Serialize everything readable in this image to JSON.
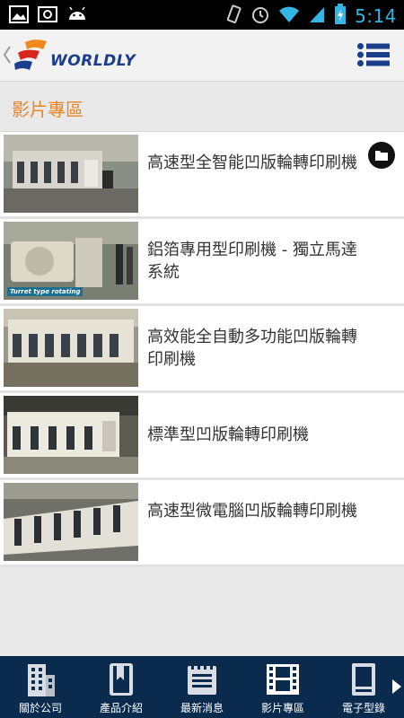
{
  "status_bar": {
    "time": "5:14"
  },
  "header": {
    "brand": "WORLDLY"
  },
  "section": {
    "title": "影片專區"
  },
  "videos": [
    {
      "title": "高速型全智能凹版輪轉印刷機"
    },
    {
      "title": "鋁箔專用型印刷機 - 獨立馬達系統",
      "thumb_caption": "Turret type rotating"
    },
    {
      "title": "高效能全自動多功能凹版輪轉印刷機"
    },
    {
      "title": "標準型凹版輪轉印刷機"
    },
    {
      "title": "高速型微電腦凹版輪轉印刷機"
    }
  ],
  "bottom_nav": [
    {
      "label": "關於公司",
      "icon": "building-icon"
    },
    {
      "label": "產品介紹",
      "icon": "book-icon"
    },
    {
      "label": "最新消息",
      "icon": "notepad-icon"
    },
    {
      "label": "影片專區",
      "icon": "film-icon"
    },
    {
      "label": "電子型錄",
      "icon": "catalog-icon"
    }
  ],
  "colors": {
    "accent": "#e8862a",
    "nav_bg": "#0a2b4e",
    "brand": "#1c3d8c",
    "clock": "#33b5e5"
  }
}
